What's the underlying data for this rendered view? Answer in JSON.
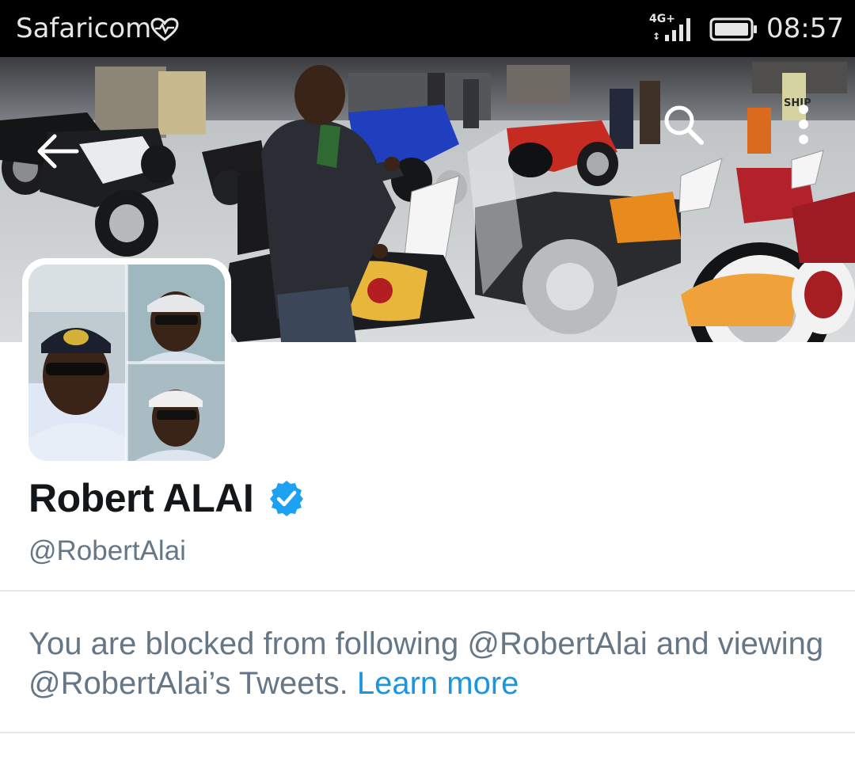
{
  "status_bar": {
    "carrier": "Safaricom",
    "network": "4G+",
    "time": "08:57"
  },
  "header": {
    "back_icon": "arrow-left-icon",
    "search_icon": "search-icon",
    "more_icon": "more-vertical-icon"
  },
  "banner": {
    "sign_text": "SHIP"
  },
  "profile": {
    "name": "Robert ALAI",
    "verified_icon": "verified-badge-icon",
    "handle": "@RobertAlai"
  },
  "notice": {
    "text": "You are blocked from following @RobertAlai and viewing @RobertAlai’s Tweets.",
    "link": "Learn more"
  },
  "colors": {
    "accent": "#1b95e0",
    "verified": "#1da1f2",
    "muted_text": "#657786",
    "primary_text": "#14171a"
  }
}
